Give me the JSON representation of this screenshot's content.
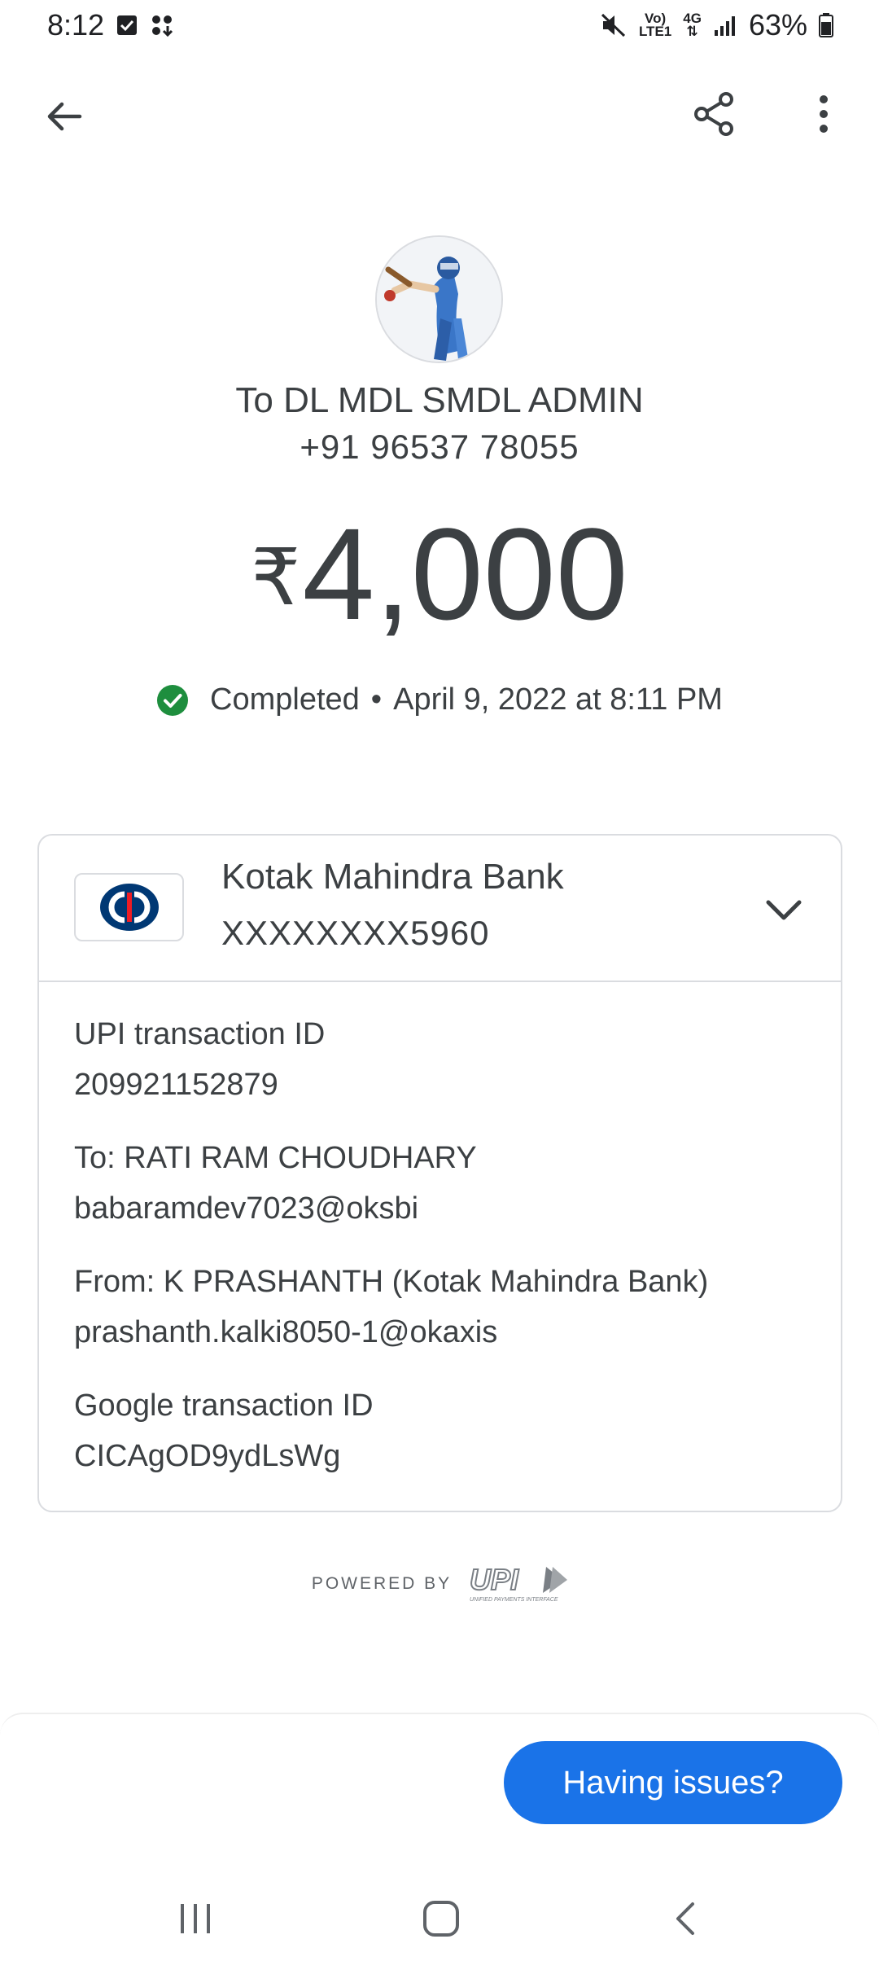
{
  "status_bar": {
    "time": "8:12",
    "network_volte": "Vo)",
    "network_lte": "LTE1",
    "network_4g": "4G",
    "battery": "63%",
    "icons": [
      "checkbox-notification-icon",
      "apps-notification-icon",
      "mute-icon",
      "signal-icon",
      "battery-icon"
    ]
  },
  "app_bar": {
    "icons": [
      "back-arrow-icon",
      "share-icon",
      "more-vert-icon"
    ]
  },
  "header": {
    "recipient_name": "To DL MDL SMDL ADMIN",
    "recipient_phone": "+91 96537 78055",
    "currency_symbol": "₹",
    "amount": "4,000",
    "status": "Completed",
    "separator": "•",
    "datetime": "April 9, 2022 at 8:11 PM"
  },
  "card": {
    "bank_name": "Kotak Mahindra Bank",
    "account_masked": "XXXXXXXX5960",
    "details": [
      {
        "label": "UPI transaction ID",
        "value": "209921152879"
      },
      {
        "label": "To: RATI RAM  CHOUDHARY",
        "value": "babaramdev7023@oksbi"
      },
      {
        "label": "From: K   PRASHANTH (Kotak Mahindra Bank)",
        "value": "prashanth.kalki8050-1@okaxis"
      },
      {
        "label": "Google transaction ID",
        "value": "CICAgOD9ydLsWg"
      }
    ]
  },
  "footer": {
    "powered_by": "POWERED BY",
    "upi_logo_text": "UPI",
    "upi_tagline": "UNIFIED PAYMENTS INTERFACE"
  },
  "bottom_sheet": {
    "issues_button": "Having issues?"
  },
  "colors": {
    "primary_blue": "#1a73e8",
    "success_green": "#1e8e3e",
    "text": "#3c4043",
    "divider": "#dadce0",
    "kotak_red": "#ed1c24",
    "kotak_navy": "#003874"
  }
}
